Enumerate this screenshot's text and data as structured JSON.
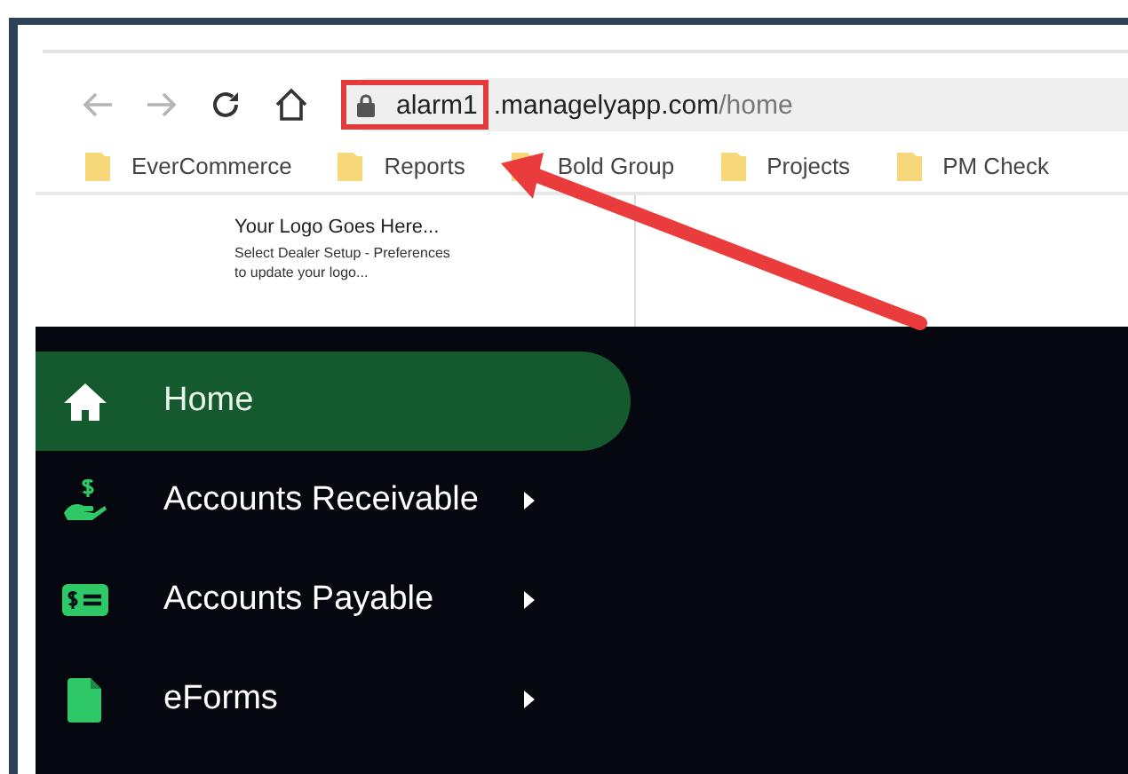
{
  "browser": {
    "url_subdomain": "alarm1",
    "url_domain": ".managelyapp.com",
    "url_path": "/home",
    "bookmarks": [
      {
        "label": "EverCommerce"
      },
      {
        "label": "Reports"
      },
      {
        "label": "Bold Group"
      },
      {
        "label": "Projects"
      },
      {
        "label": "PM Check"
      }
    ]
  },
  "logo": {
    "title": "Your Logo Goes Here...",
    "hint": "Select Dealer Setup - Preferences to update your logo..."
  },
  "sidebar": {
    "items": [
      {
        "label": "Home",
        "selected": true,
        "submenu": false
      },
      {
        "label": "Accounts Receivable",
        "selected": false,
        "submenu": true
      },
      {
        "label": "Accounts Payable",
        "selected": false,
        "submenu": true
      },
      {
        "label": "eForms",
        "selected": false,
        "submenu": true
      }
    ]
  }
}
